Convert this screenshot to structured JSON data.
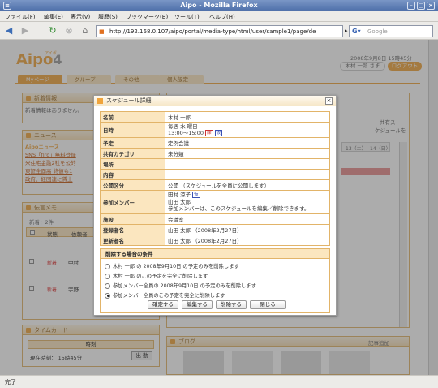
{
  "window": {
    "title": "Aipo - Mozilla Firefox"
  },
  "menubar": [
    "ファイル(F)",
    "編集(E)",
    "表示(V)",
    "履歴(S)",
    "ブックマーク(B)",
    "ツール(T)",
    "ヘルプ(H)"
  ],
  "nav": {
    "url": "http://192.168.0.107/aipo/portal/media-type/html/user/sample1/page/de",
    "search_placeholder": "Google"
  },
  "header": {
    "logo": "Aipo",
    "logo_num": "4",
    "logo_small": "アイポ",
    "date": "2008年9月8日 15時45分",
    "user": "木村 一郎 さま",
    "logout": "ログアウト"
  },
  "tabs": [
    "Myページ",
    "グループ",
    "その他",
    "個人設定"
  ],
  "portlets": {
    "new_info": {
      "title": "新着情報",
      "text": "新着情報はありません。"
    },
    "news": {
      "title": "ニュース",
      "brand": "Aipoニュース",
      "items": [
        "SNS「firo」無料登録",
        "米住宅金融2社を公的",
        "東証全面高 終値も1",
        "政府、経団連に賃上"
      ]
    },
    "memo": {
      "title": "伝言メモ",
      "count": "新着：2件",
      "col_status": "状態",
      "col_from": "依頼者",
      "rows": [
        {
          "status": "新着",
          "from": "中村"
        },
        {
          "status": "新着",
          "from": "宇野"
        }
      ]
    },
    "timecard": {
      "title": "タイムカード",
      "col": "時刻",
      "current": "現在時刻： 15時45分",
      "button": "出 勤"
    },
    "blog": {
      "title": "ブログ",
      "add": "記事追加"
    },
    "schedule_bg": {
      "col1": "13（土）",
      "col2": "14（日）",
      "share": "共有ス",
      "share2": "ケジュールを"
    }
  },
  "dialog": {
    "title": "スケジュール詳細",
    "rows": [
      {
        "k": "名前",
        "v": "木村 一郎"
      },
      {
        "k": "日時",
        "v": "毎週 水 曜日",
        "v2": "13:00～15:00",
        "tag1": "繰",
        "tag2": "仮"
      },
      {
        "k": "予定",
        "v": "定例会議"
      },
      {
        "k": "共有カテゴリ",
        "v": "未分類"
      },
      {
        "k": "場所",
        "v": ""
      },
      {
        "k": "内容",
        "v": ""
      },
      {
        "k": "公開区分",
        "v": "公開 （スケジュールを全員に公開します）"
      },
      {
        "k": "参加メンバー",
        "v": "田村 涼子",
        "tag": "仮",
        "v2": "山田 太郎",
        "v3": "参加メンバーは、このスケジュールを編集／削除できます。"
      },
      {
        "k": "施設",
        "v": "会議室"
      },
      {
        "k": "登録者名",
        "v": "山田 太郎 （2008年2月27日）"
      },
      {
        "k": "更新者名",
        "v": "山田 太郎 （2008年2月27日）"
      }
    ],
    "conditions": {
      "title": "削除する場合の条件",
      "options": [
        "木村 一郎 の 2008年9月10日 の予定のみを削除します",
        "木村 一郎 のこの予定を完全に削除します",
        "参加メンバー全員の 2008年9月10日 の予定のみを削除します",
        "参加メンバー全員のこの予定を完全に削除します"
      ],
      "selected": 3
    },
    "buttons": [
      "確定する",
      "編集する",
      "削除する",
      "閉じる"
    ]
  },
  "status": "完了"
}
